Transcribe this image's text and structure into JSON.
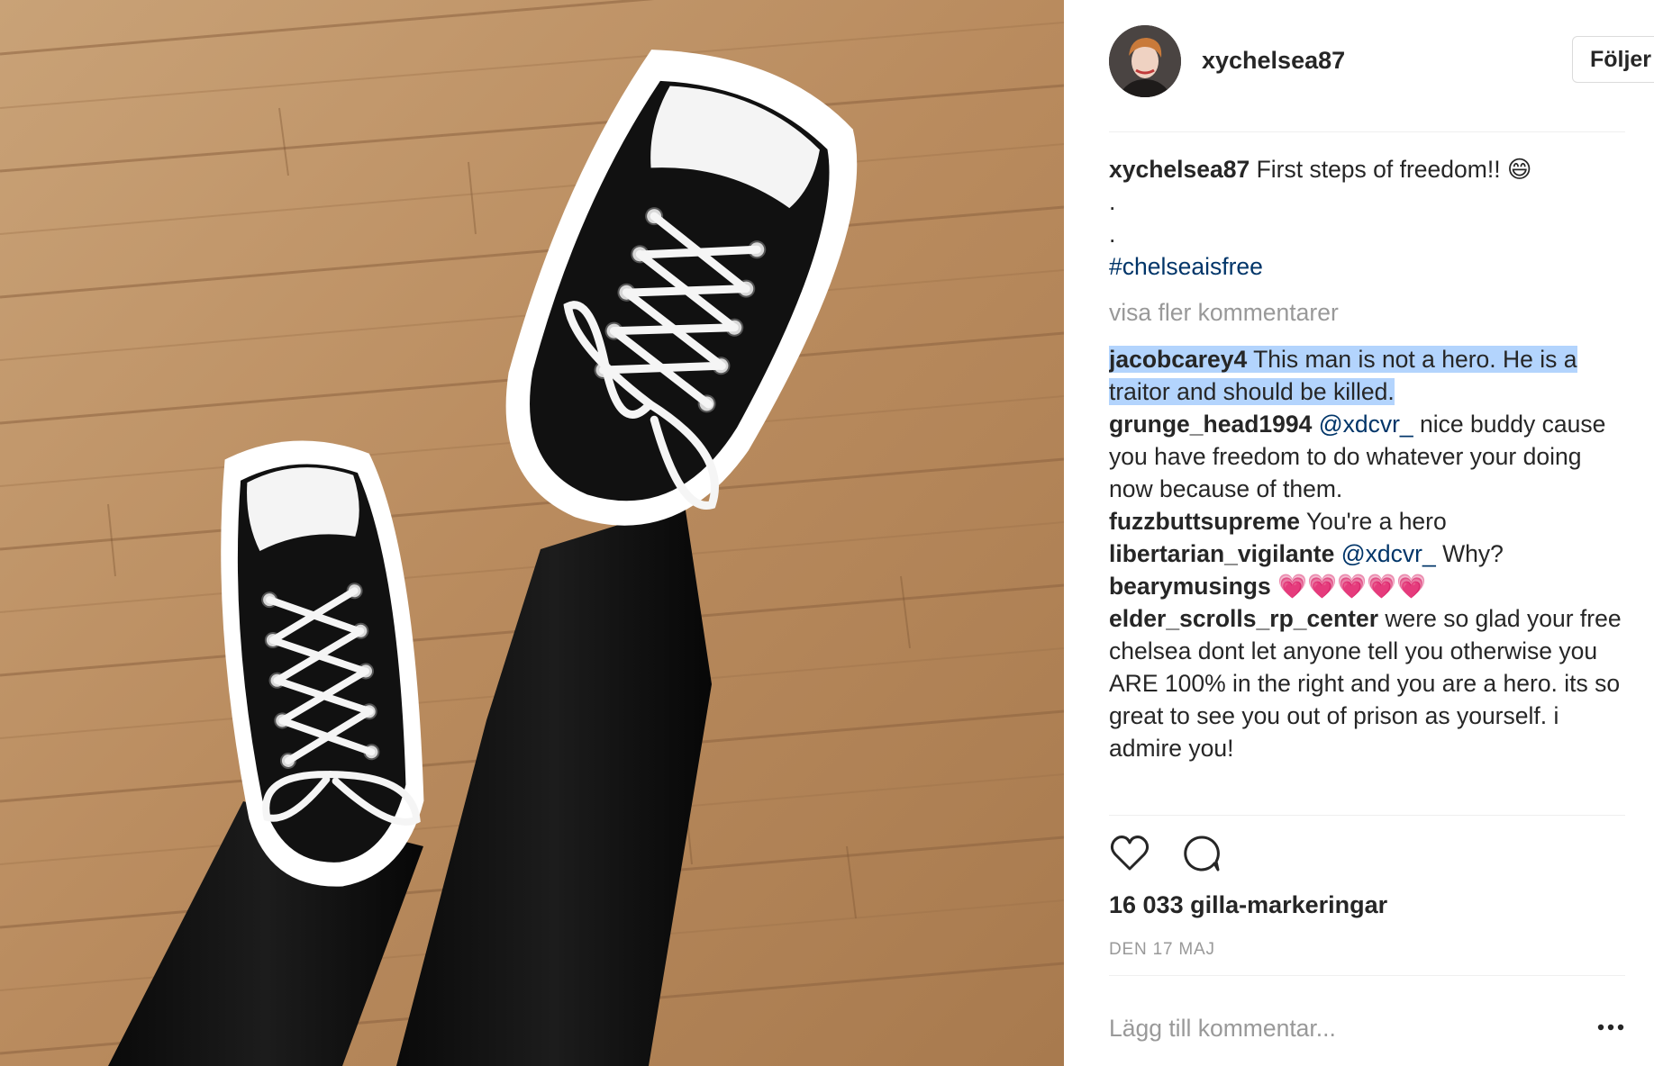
{
  "post": {
    "author": "xychelsea87",
    "follow_label": "Följer"
  },
  "caption": {
    "username": "xychelsea87",
    "text": "First steps of freedom!! 😄",
    "dot1": ".",
    "dot2": ".",
    "hashtag": "#chelseaisfree"
  },
  "comments": {
    "load_more_label": "visa fler kommentarer",
    "items": [
      {
        "username": "jacobcarey4",
        "mention": "",
        "text": "This man is not a hero. He is a traitor and should be killed.",
        "highlighted": true
      },
      {
        "username": "grunge_head1994",
        "mention": "@xdcvr_",
        "text": "nice buddy cause you have freedom to do whatever your doing now because of them."
      },
      {
        "username": "fuzzbuttsupreme",
        "mention": "",
        "text": "You're a hero"
      },
      {
        "username": "libertarian_vigilante",
        "mention": "@xdcvr_",
        "text": "Why?"
      },
      {
        "username": "bearymusings",
        "mention": "",
        "text": "💗💗💗💗💗"
      },
      {
        "username": "elder_scrolls_rp_center",
        "mention": "",
        "text": "were so glad your free chelsea dont let anyone tell you otherwise you ARE 100% in the right and you are a hero. its so great to see you out of prison as yourself. i admire you!"
      }
    ]
  },
  "actions": {
    "like_icon": "heart-icon",
    "comment_icon": "speech-bubble-icon"
  },
  "likes_label": "16 033 gilla-markeringar",
  "date_label": "DEN 17 MAJ",
  "add_comment": {
    "placeholder": "Lägg till kommentar...",
    "options_icon": "ellipsis-icon"
  },
  "colors": {
    "text": "#262626",
    "muted": "#999999",
    "link": "#003569",
    "selection": "#b3d4fd",
    "border": "#dbdbdb"
  }
}
